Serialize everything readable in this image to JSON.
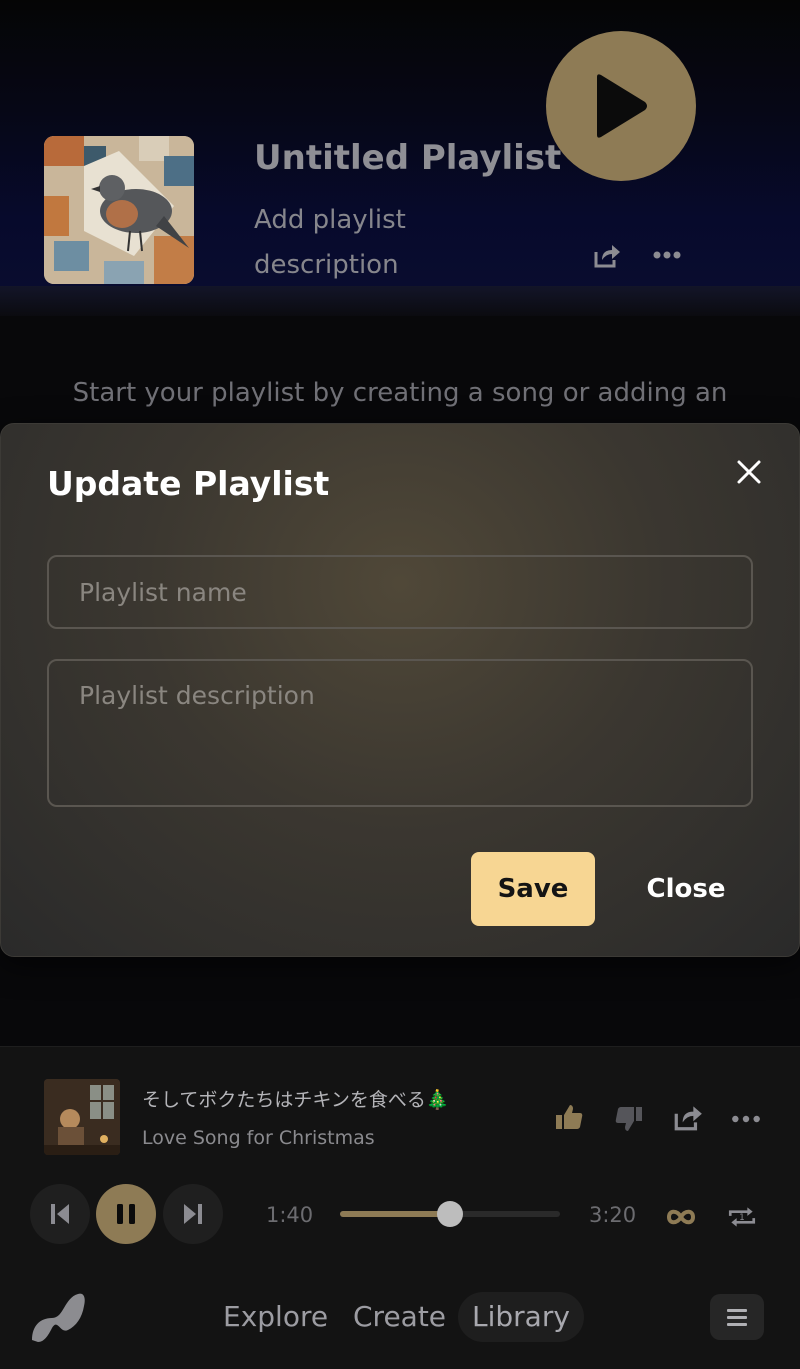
{
  "playlist": {
    "title": "Untitled Playlist",
    "description_prompt": "Add playlist description",
    "empty_message": "Start your playlist by creating a song or adding an"
  },
  "modal": {
    "title": "Update Playlist",
    "name_placeholder": "Playlist name",
    "description_placeholder": "Playlist description",
    "save_label": "Save",
    "close_label": "Close"
  },
  "now_playing": {
    "title": "そしてボクたちはチキンを食べる🎄",
    "subtitle": "Love Song for Christmas",
    "elapsed": "1:40",
    "duration": "3:20",
    "progress_fraction": 0.5
  },
  "nav": {
    "items": [
      "Explore",
      "Create",
      "Library"
    ],
    "active": "Library"
  },
  "colors": {
    "accent": "#8e7b55",
    "save_button": "#f7d693"
  }
}
